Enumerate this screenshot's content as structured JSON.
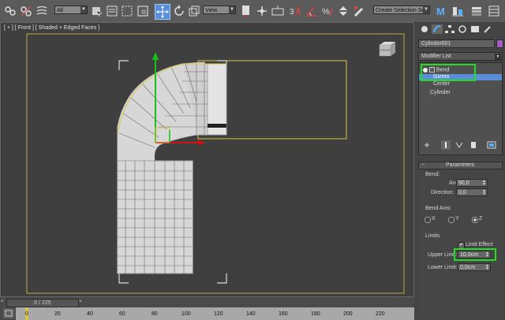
{
  "toolbar": {
    "filter_dropdown": "All",
    "coord_dropdown": "View",
    "selection_set_placeholder": "Create Selection Se"
  },
  "viewport": {
    "label": "[ + ] [ Front ] [ Shaded + Edged Faces ]",
    "viewcube_label": "FRONT"
  },
  "command_panel": {
    "object_name": "Cylinder001",
    "modifier_list": "Modifier List",
    "stack": [
      {
        "label": "Bend",
        "selected": false
      },
      {
        "label": "Gizmo",
        "selected": true
      },
      {
        "label": "Center",
        "selected": false
      },
      {
        "label": "Cylinder",
        "selected": false
      }
    ],
    "rollout_title": "Parameters",
    "bend_group": "Bend:",
    "angle_label": "Angle:",
    "angle_value": "90,0",
    "direction_label": "Direction:",
    "direction_value": "0,0",
    "bend_axis_label": "Bend Axis:",
    "axis_x": "X",
    "axis_y": "Y",
    "axis_z": "Z",
    "selected_axis": "Z",
    "limits_group": "Limits",
    "limit_effect_label": "Limit Effect",
    "upper_limit_label": "Upper Limit:",
    "upper_limit_value": "10,0cm",
    "lower_limit_label": "Lower Limit:",
    "lower_limit_value": "0,0cm"
  },
  "timeline": {
    "frame_display": "0 / 225",
    "ticks": [
      "0",
      "20",
      "40",
      "60",
      "80",
      "100",
      "120",
      "140",
      "160",
      "180",
      "200",
      "220"
    ]
  }
}
